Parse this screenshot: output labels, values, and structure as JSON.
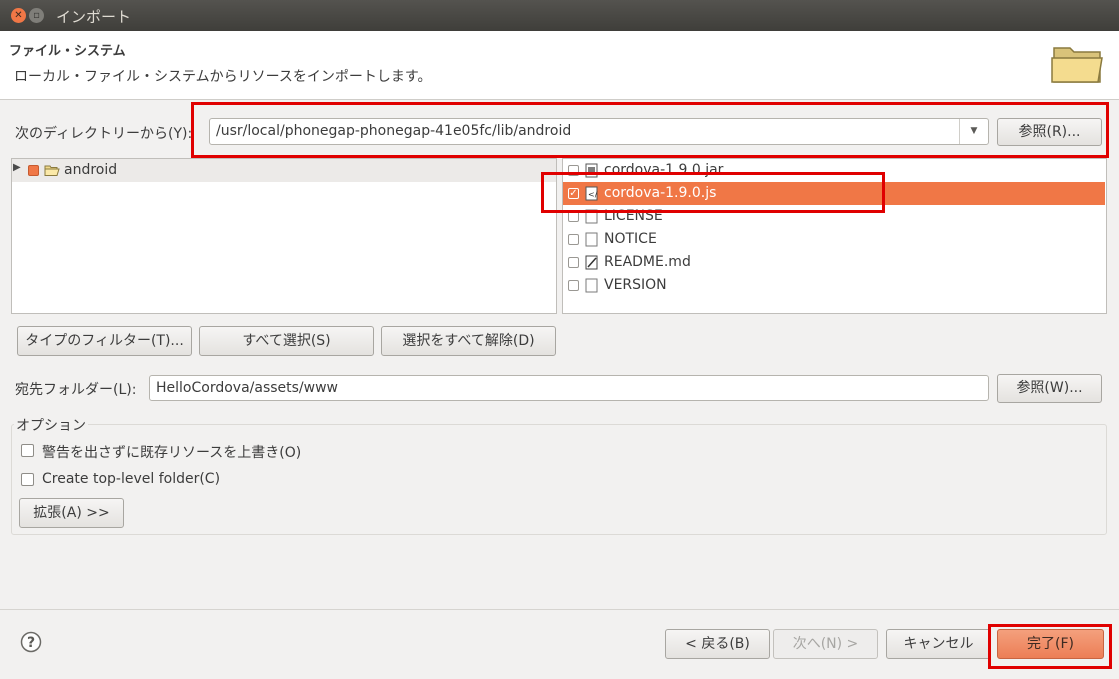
{
  "window": {
    "title": "インポート"
  },
  "header": {
    "title": "ファイル・システム",
    "description": "ローカル・ファイル・システムからリソースをインポートします。"
  },
  "source": {
    "label": "次のディレクトリーから(Y):",
    "value": "/usr/local/phonegap-phonegap-41e05fc/lib/android",
    "browse_label": "参照(R)..."
  },
  "tree": {
    "items": [
      {
        "label": "android",
        "expanded": false
      }
    ]
  },
  "files": [
    {
      "name": "cordova-1.9.0.jar",
      "checked": false,
      "selected": false,
      "icon": "jar-file-icon"
    },
    {
      "name": "cordova-1.9.0.js",
      "checked": true,
      "selected": true,
      "icon": "js-file-icon"
    },
    {
      "name": "LICENSE",
      "checked": false,
      "selected": false,
      "icon": "text-file-icon"
    },
    {
      "name": "NOTICE",
      "checked": false,
      "selected": false,
      "icon": "text-file-icon"
    },
    {
      "name": "README.md",
      "checked": false,
      "selected": false,
      "icon": "edit-file-icon"
    },
    {
      "name": "VERSION",
      "checked": false,
      "selected": false,
      "icon": "text-file-icon"
    }
  ],
  "selection_buttons": {
    "filter_types": "タイプのフィルター(T)...",
    "select_all": "すべて選択(S)",
    "deselect_all": "選択をすべて解除(D)"
  },
  "destination": {
    "label": "宛先フォルダー(L):",
    "value": "HelloCordova/assets/www",
    "browse_label": "参照(W)..."
  },
  "options": {
    "group_label": "オプション",
    "overwrite_label": "警告を出さずに既存リソースを上書き(O)",
    "overwrite_checked": false,
    "toplevel_label": "Create top-level folder(C)",
    "toplevel_checked": false,
    "advanced_label": "拡張(A) >>"
  },
  "footer": {
    "back_label": "< 戻る(B)",
    "next_label": "次へ(N) >",
    "cancel_label": "キャンセル",
    "finish_label": "完了(F)"
  },
  "colors": {
    "accent": "#f07746",
    "highlight_box": "#e00000"
  }
}
